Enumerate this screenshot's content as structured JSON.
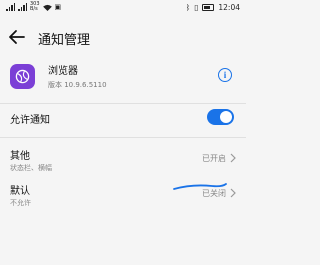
{
  "status_bar": {
    "network_top": "303",
    "network_bottom": "B/s",
    "time": "12:04"
  },
  "header": {
    "title": "通知管理"
  },
  "app": {
    "name": "浏览器",
    "version": "版本 10.9.6.5110",
    "info_symbol": "i",
    "icon_color": "#7b3fd6"
  },
  "allow_notifications": {
    "label": "允许通知",
    "enabled": true,
    "accent": "#1a73e8"
  },
  "categories": [
    {
      "title": "其他",
      "subtitle": "状态栏、横幅",
      "status": "已开启"
    },
    {
      "title": "默认",
      "subtitle": "不允许",
      "status": "已关闭"
    }
  ]
}
